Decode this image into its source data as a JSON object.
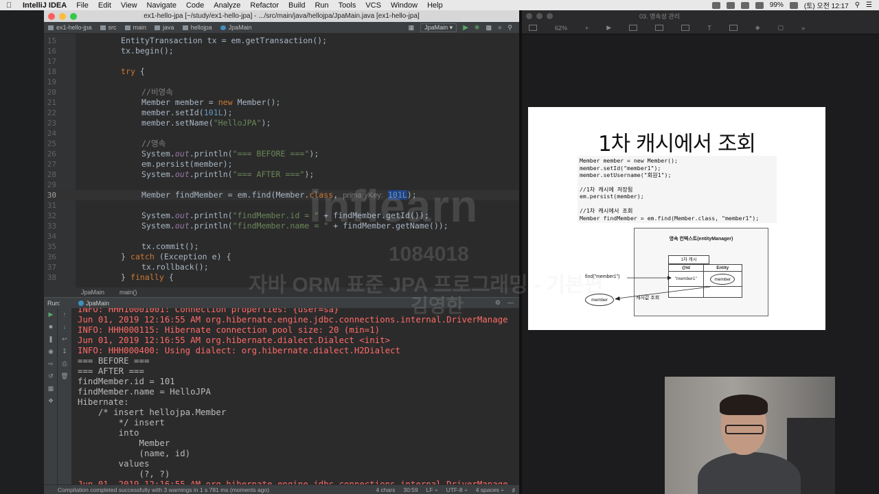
{
  "menubar": {
    "items": [
      "IntelliJ IDEA",
      "File",
      "Edit",
      "View",
      "Navigate",
      "Code",
      "Analyze",
      "Refactor",
      "Build",
      "Run",
      "Tools",
      "VCS",
      "Window",
      "Help"
    ],
    "battery": "99%",
    "clock": "(토) 오전 12:17"
  },
  "ide": {
    "window_title": "ex1-hello-jpa [~/study/ex1-hello-jpa] - .../src/main/java/hellojpa/JpaMain.java [ex1-hello-jpa]",
    "breadcrumbs": [
      "ex1-hello-jpa",
      "src",
      "main",
      "java",
      "hellojpa",
      "JpaMain"
    ],
    "run_config": "JpaMain",
    "code_lines": [
      {
        "n": "15",
        "html": "<span>EntityTransaction tx = em.getTransaction();</span>",
        "indent": 2
      },
      {
        "n": "16",
        "text": "tx.begin();",
        "indent": 2
      },
      {
        "n": "17",
        "text": "",
        "indent": 2
      },
      {
        "n": "18",
        "text": "try {",
        "indent": 2,
        "kw": "try"
      },
      {
        "n": "19",
        "text": "",
        "indent": 2
      },
      {
        "n": "20",
        "text": "//비영속",
        "indent": 3,
        "comment": true
      },
      {
        "n": "21",
        "text": "Member member = new Member();",
        "indent": 3
      },
      {
        "n": "22",
        "text": "member.setId(101L);",
        "indent": 3
      },
      {
        "n": "23",
        "text": "member.setName(\"HelloJPA\");",
        "indent": 3
      },
      {
        "n": "24",
        "text": "",
        "indent": 3
      },
      {
        "n": "25",
        "text": "//영속",
        "indent": 3,
        "comment": true
      },
      {
        "n": "26",
        "text": "System.out.println(\"=== BEFORE ===\");",
        "indent": 3
      },
      {
        "n": "27",
        "text": "em.persist(member);",
        "indent": 3
      },
      {
        "n": "28",
        "text": "System.out.println(\"=== AFTER ===\");",
        "indent": 3
      },
      {
        "n": "29",
        "text": "",
        "indent": 3
      },
      {
        "n": "30",
        "text": "Member findMember = em.find(Member.class, primaryKey: 101L);",
        "indent": 3
      },
      {
        "n": "31",
        "text": "",
        "indent": 3
      },
      {
        "n": "32",
        "text": "System.out.println(\"findMember.id = \" + findMember.getId());",
        "indent": 3
      },
      {
        "n": "33",
        "text": "System.out.println(\"findMember.name = \" + findMember.getName());",
        "indent": 3
      },
      {
        "n": "34",
        "text": "",
        "indent": 3
      },
      {
        "n": "35",
        "text": "tx.commit();",
        "indent": 3
      },
      {
        "n": "36",
        "text": "} catch (Exception e) {",
        "indent": 2
      },
      {
        "n": "37",
        "text": "tx.rollback();",
        "indent": 3
      },
      {
        "n": "38",
        "text": "} finally {",
        "indent": 2
      }
    ],
    "editor_crumbs": [
      "JpaMain",
      "main()"
    ],
    "run_label": "Run:",
    "run_tab": "JpaMain",
    "console_lines": [
      {
        "t": "INFO: HHH10001001: Connection properties: {user=sa}",
        "err": true
      },
      {
        "t": "Jun 01, 2019 12:16:55 AM org.hibernate.engine.jdbc.connections.internal.DriverManage",
        "err": true
      },
      {
        "t": "INFO: HHH000115: Hibernate connection pool size: 20 (min=1)",
        "err": true
      },
      {
        "t": "Jun 01, 2019 12:16:55 AM org.hibernate.dialect.Dialect <init>",
        "err": true
      },
      {
        "t": "INFO: HHH000400: Using dialect: org.hibernate.dialect.H2Dialect",
        "err": true
      },
      {
        "t": "=== BEFORE ===",
        "err": false
      },
      {
        "t": "=== AFTER ===",
        "err": false
      },
      {
        "t": "findMember.id = 101",
        "err": false
      },
      {
        "t": "findMember.name = HelloJPA",
        "err": false
      },
      {
        "t": "Hibernate:",
        "err": false
      },
      {
        "t": "    /* insert hellojpa.Member",
        "err": false
      },
      {
        "t": "        */ insert",
        "err": false
      },
      {
        "t": "        into",
        "err": false
      },
      {
        "t": "            Member",
        "err": false
      },
      {
        "t": "            (name, id)",
        "err": false
      },
      {
        "t": "        values",
        "err": false
      },
      {
        "t": "            (?, ?)",
        "err": false
      },
      {
        "t": "Jun 01, 2019 12:16:55 AM org.hibernate.engine.jdbc.connections.internal.DriverManage",
        "err": true
      }
    ],
    "status_message": "Compilation completed successfully with 3 warnings in 1 s 781 ms (moments ago)",
    "status_right": [
      "4 chars",
      "30:59",
      "LF ÷",
      "UTF-8 ÷",
      "4 spaces ÷"
    ]
  },
  "keynote": {
    "doc_title": "03. 영속성 관리",
    "zoom": "62%",
    "slide": {
      "title": "1차 캐시에서 조회",
      "code": [
        "Member member = new Member();",
        "member.setId(\"member1\");",
        "member.setUsername(\"회원1\");",
        "",
        "//1차 캐시에 저장됨",
        "em.persist(member);",
        "",
        "//1차 캐시에서 조회",
        "Member findMember = em.find(Member.class, \"member1\");"
      ],
      "diagram": {
        "context_title": "영속 컨텍스트(entityManager)",
        "cache_label": "1차 캐시",
        "col_id": "@Id",
        "col_entity": "Entity",
        "cell_key": "\"member1\"",
        "cell_entity": "member",
        "find_call": "find(\"member1\")",
        "return_label": "캐시값 조회",
        "member_oval": "member"
      }
    }
  },
  "watermark": {
    "brand": "inflearn",
    "id": "1084018",
    "course": "자바 ORM 표준 JPA 프로그래밍 - 기본편",
    "author": "김영한"
  }
}
